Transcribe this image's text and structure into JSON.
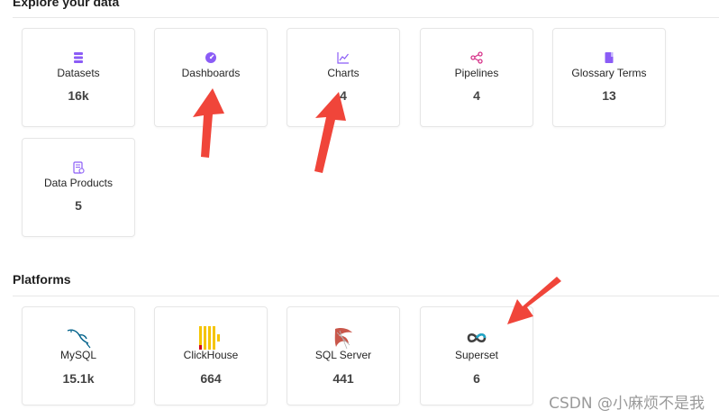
{
  "explore": {
    "title": "Explore your data",
    "cards": [
      {
        "label": "Datasets",
        "count": "16k",
        "icon": "datasets-icon"
      },
      {
        "label": "Dashboards",
        "count": "",
        "icon": "dashboards-icon"
      },
      {
        "label": "Charts",
        "count": "4",
        "icon": "charts-icon"
      },
      {
        "label": "Pipelines",
        "count": "4",
        "icon": "pipelines-icon"
      },
      {
        "label": "Glossary Terms",
        "count": "13",
        "icon": "glossary-icon"
      },
      {
        "label": "Data Products",
        "count": "5",
        "icon": "data-products-icon"
      }
    ]
  },
  "platforms": {
    "title": "Platforms",
    "cards": [
      {
        "label": "MySQL",
        "count": "15.1k",
        "icon": "mysql-icon"
      },
      {
        "label": "ClickHouse",
        "count": "664",
        "icon": "clickhouse-icon"
      },
      {
        "label": "SQL Server",
        "count": "441",
        "icon": "sql-server-icon"
      },
      {
        "label": "Superset",
        "count": "6",
        "icon": "superset-icon"
      }
    ]
  },
  "watermark": "CSDN @小麻烦不是我",
  "colors": {
    "accent": "#8b5cf6",
    "pink": "#d6338a",
    "annotation_arrow": "#f0453a"
  }
}
